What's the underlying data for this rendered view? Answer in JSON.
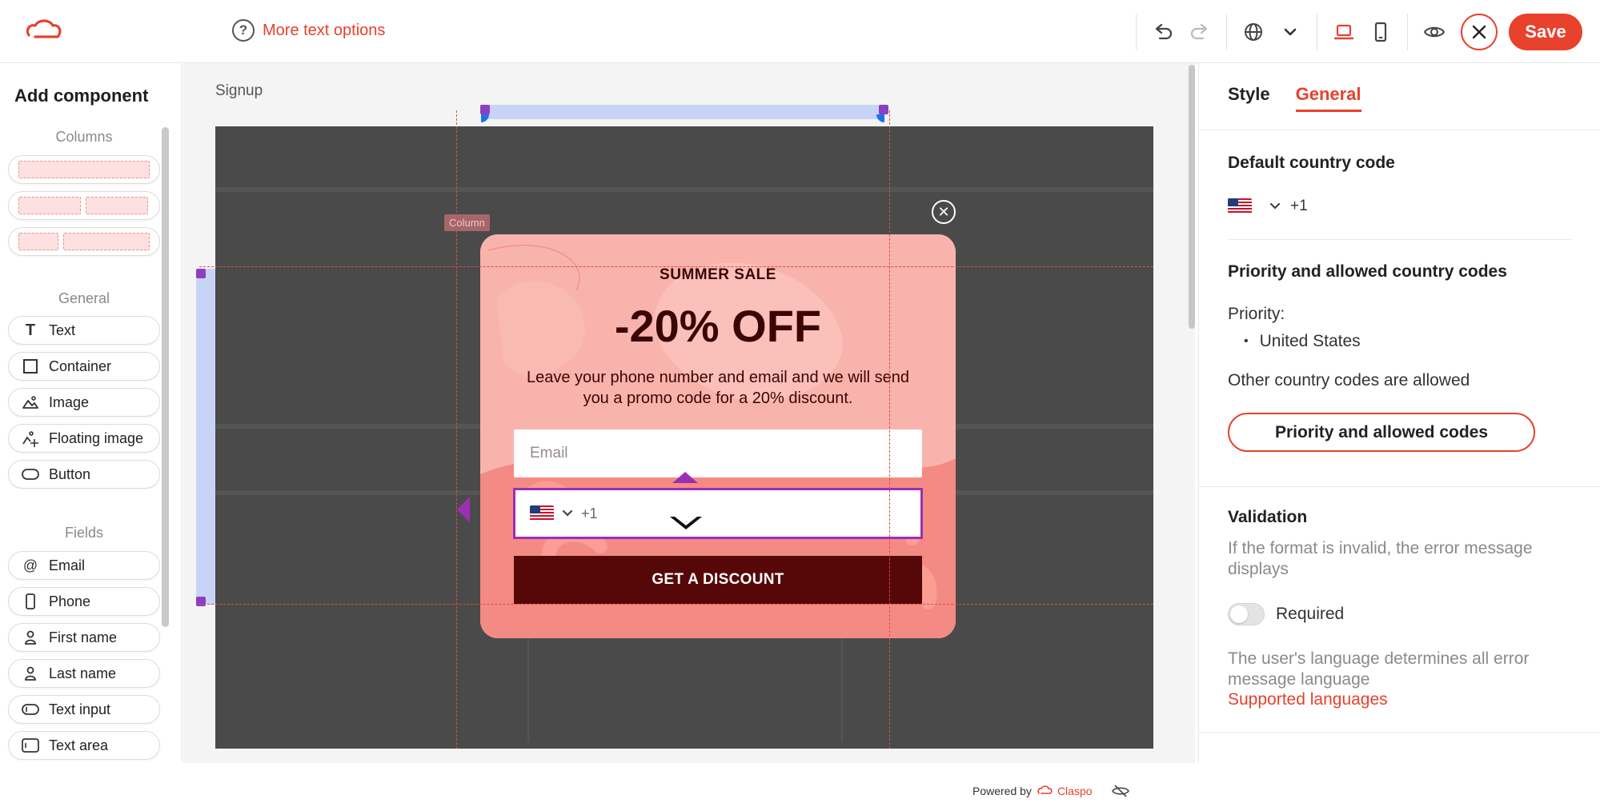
{
  "toolbar": {
    "help_label": "More text options",
    "help_icon": "question-circle-icon",
    "save_label": "Save",
    "accent": "#e8412c"
  },
  "left_panel": {
    "title": "Add component",
    "columns_title": "Columns",
    "general_title": "General",
    "general_items": [
      "Text",
      "Container",
      "Image",
      "Floating image",
      "Button"
    ],
    "fields_title": "Fields",
    "field_items": [
      "Email",
      "Phone",
      "First name",
      "Last name",
      "Text input",
      "Text area"
    ]
  },
  "canvas": {
    "page_label": "Signup",
    "column_tag": "Column",
    "popup": {
      "subtitle": "SUMMER SALE",
      "title": "-20% OFF",
      "description": "Leave your phone number and email and we will send you a promo code for a 20% discount.",
      "email_placeholder": "Email",
      "phone_code": "+1",
      "button_label": "GET A DISCOUNT",
      "button_color": "#560808",
      "bg_color": "#f7a8a2"
    },
    "powered_by": "Powered by",
    "powered_brand": "Claspo"
  },
  "right_panel": {
    "tabs": [
      "Style",
      "General"
    ],
    "active_tab": "General",
    "default_cc_title": "Default country code",
    "default_cc_value": "+1",
    "priority_title": "Priority and allowed country codes",
    "priority_label": "Priority:",
    "priority_list": [
      "United States"
    ],
    "other_allowed": "Other country codes are allowed",
    "priority_button": "Priority and allowed codes",
    "validation_title": "Validation",
    "validation_desc": "If the format is invalid, the error message displays",
    "required_label": "Required",
    "required_on": false,
    "language_desc": "The user's language determines all error message language",
    "supported_link": "Supported languages"
  }
}
